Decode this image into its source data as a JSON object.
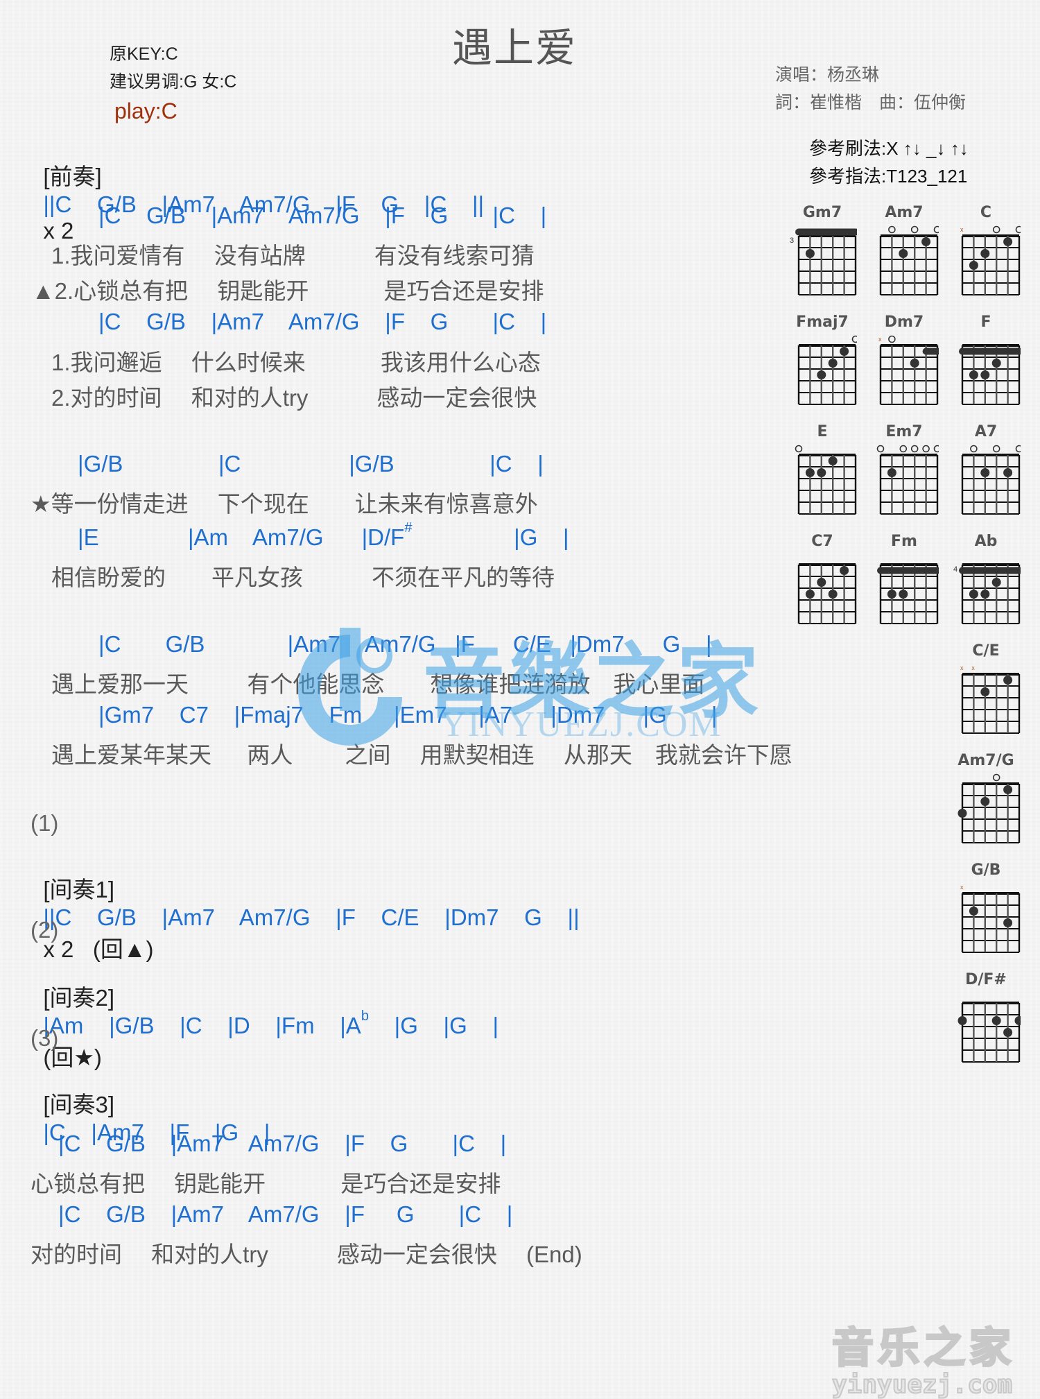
{
  "header": {
    "title": "遇上爱",
    "original_key": "原KEY:C",
    "suggested_key": "建议男调:G 女:C",
    "play_key": "play:C",
    "singer": "演唱：杨丞琳",
    "writers": "詞：崔惟楷　曲：伍仲衡",
    "strum_pattern": "參考刷法:X ↑↓ _↓ ↑↓",
    "finger_pattern": "參考指法:T123_121"
  },
  "colors": {
    "chord": "#1f6fd0",
    "lyric": "#5a5a5a",
    "play_key": "#a0300c",
    "watermark": "#3ca0e6"
  },
  "intro": {
    "label": "[前奏]",
    "chords": "||C    G/B    |Am7    Am7/G    |F    G    |C    ||",
    "repeat": "x 2"
  },
  "verse": [
    {
      "chords": "|C    G/B    |Am7    Am7/G    |F    G       |C    |"
    },
    {
      "lyric": "1.我问爱情有　 没有站牌　　　有没有线索可猜"
    },
    {
      "lyric": "▲2.心锁总有把　 钥匙能开　　　 是巧合还是安排"
    },
    {
      "chords": "|C    G/B    |Am7    Am7/G    |F    G       |C    |"
    },
    {
      "lyric": "1.我问邂逅　 什么时候来　　　 我该用什么心态"
    },
    {
      "lyric": "2.对的时间　 和对的人try　　　感动一定会很快"
    }
  ],
  "prechorus": [
    {
      "chords": "|G/B               |C                 |G/B               |C    |"
    },
    {
      "lyric": "★等一份情走进　 下个现在　　让未来有惊喜意外"
    },
    {
      "chords_parts": [
        "|E              |Am    Am7/G      |D/F",
        "#",
        "                |G    |"
      ]
    },
    {
      "lyric": "相信盼爱的　　平凡女孩　　　不须在平凡的等待"
    }
  ],
  "chorus": [
    {
      "chords": "|C       G/B             |Am7    Am7/G   |F      C/E   |Dm7      G    |"
    },
    {
      "lyric": "遇上爱那一天　　  有个他能思念　　想像谁把涟漪放　我心里面"
    },
    {
      "chords": "|Gm7    C7    |Fmaj7    Fm     |Em7     |A7      |Dm7      |G       |"
    },
    {
      "lyric": "遇上爱某年某天　  两人　　 之间　 用默契相连　 从那天　我就会许下愿"
    }
  ],
  "interludes": [
    {
      "num": "(1)",
      "label": "[间奏1]",
      "chords": "||C    G/B    |Am7    Am7/G    |F    C/E    |Dm7    G    ||",
      "tail": "x 2   (回▲)"
    },
    {
      "num": "(2)",
      "label": "[间奏2]",
      "chords_a": "|Am    |G/B    |C    |D    |Fm    |A",
      "flat": "b",
      "chords_b": "    |G    |G    |",
      "tail": "(回★)"
    },
    {
      "num": "(3)",
      "label": "[间奏3]",
      "chords": "|C    |Am7    |F    |G    |"
    }
  ],
  "outro": [
    {
      "chords": "|C    G/B    |Am7    Am7/G    |F    G       |C    |"
    },
    {
      "lyric": "心锁总有把　 钥匙能开　　　 是巧合还是安排"
    },
    {
      "chords": "|C    G/B    |Am7    Am7/G    |F     G       |C    |"
    },
    {
      "lyric": "对的时间　 和对的人try　　　感动一定会很快　 (End)"
    }
  ],
  "chord_diagrams": [
    {
      "name": "Gm7",
      "base_fret": "3"
    },
    {
      "name": "Am7"
    },
    {
      "name": "C"
    },
    {
      "name": "Fmaj7"
    },
    {
      "name": "Dm7"
    },
    {
      "name": "F"
    },
    {
      "name": "E"
    },
    {
      "name": "Em7"
    },
    {
      "name": "A7"
    },
    {
      "name": "C7"
    },
    {
      "name": "Fm"
    },
    {
      "name": "Ab",
      "base_fret": "4"
    },
    {
      "name": "C/E"
    },
    {
      "name": "Am7/G"
    },
    {
      "name": "G/B"
    },
    {
      "name": "D/F#"
    }
  ],
  "watermarks": {
    "center_cn": "音樂之家",
    "center_en": "YINYUEZJ.COM",
    "corner_cn": "音乐之家",
    "corner_en": "yinyuezj.com"
  }
}
